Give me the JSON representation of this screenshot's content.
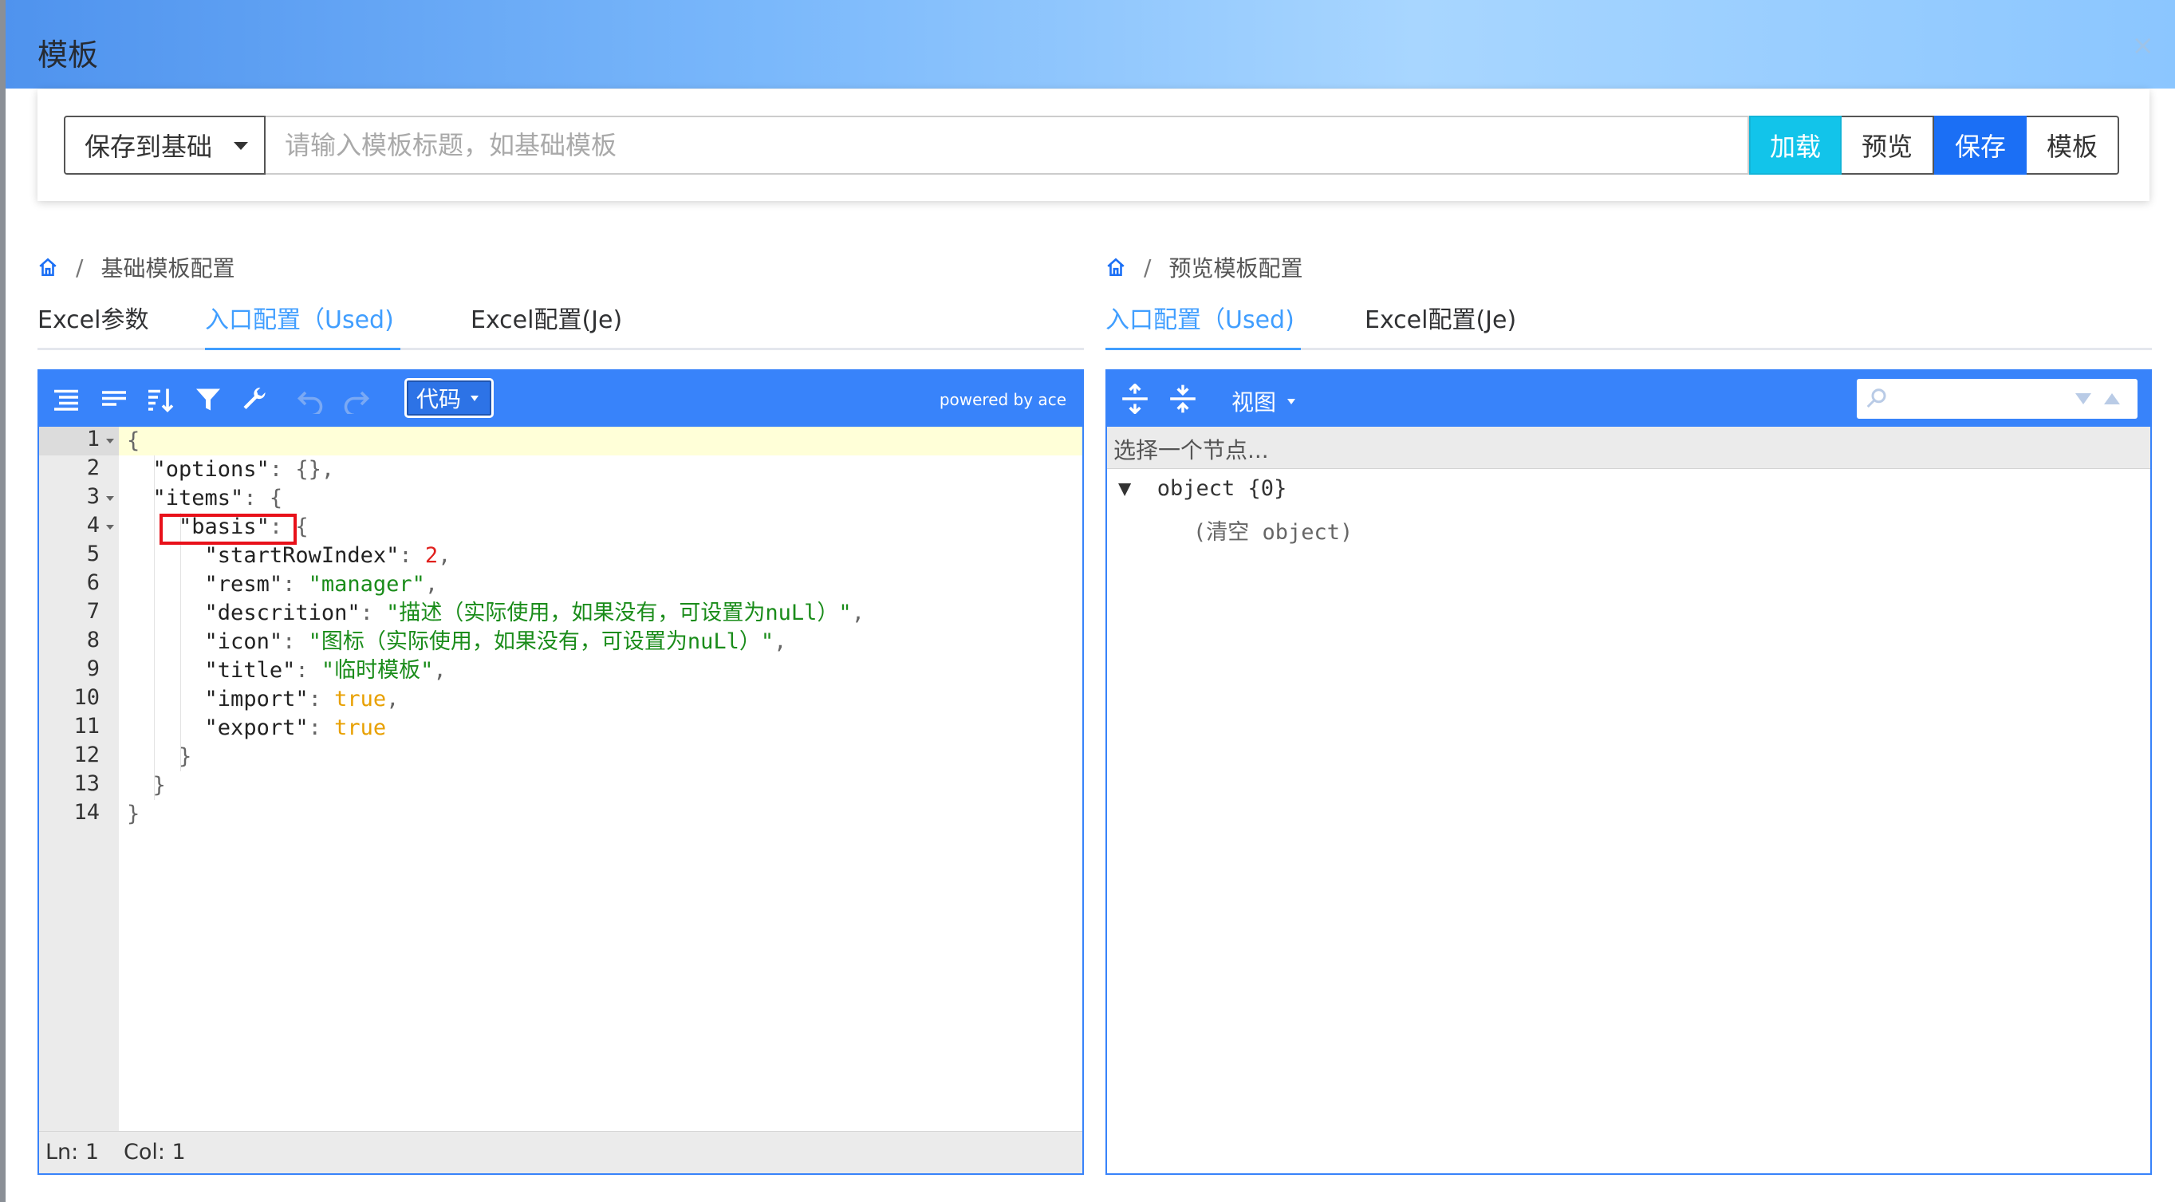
{
  "dialog": {
    "title": "模板",
    "close_glyph": "×"
  },
  "toolbar": {
    "save_target": "保存到基础",
    "title_placeholder": "请输入模板标题，如基础模板",
    "load_label": "加载",
    "preview_label": "预览",
    "save_label": "保存",
    "template_label": "模板"
  },
  "left": {
    "breadcrumb": "基础模板配置",
    "tabs": [
      "Excel参数",
      "入口配置（Used)",
      "Excel配置(Je)"
    ],
    "active_tab": 1,
    "editor": {
      "mode_label": "代码",
      "powered_by": "powered by ace",
      "status_ln": "Ln: 1",
      "status_col": "Col: 1",
      "line_numbers": [
        "1",
        "2",
        "3",
        "4",
        "5",
        "6",
        "7",
        "8",
        "9",
        "10",
        "11",
        "12",
        "13",
        "14"
      ]
    }
  },
  "right": {
    "breadcrumb": "预览模板配置",
    "tabs": [
      "入口配置（Used)",
      "Excel配置(Je)"
    ],
    "active_tab": 0,
    "tree": {
      "view_label": "视图",
      "hint": "选择一个节点...",
      "root_label": "▼  object {0}",
      "empty_label": "(清空 object)"
    }
  },
  "colors": {
    "editor_accent": "#3883fa",
    "load_button": "#12c4ea",
    "save_button": "#1b6ff5",
    "active_tab": "#409eff",
    "highlight_box": "#e8111a"
  }
}
